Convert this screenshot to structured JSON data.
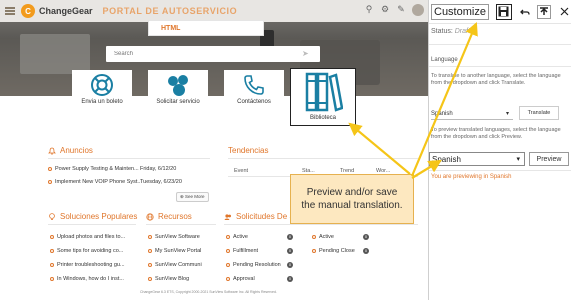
{
  "header": {
    "brand": "ChangeGear",
    "portal_title": "PORTAL DE AUTOSERVICIO",
    "html_box": "HTML",
    "search_placeholder": "Search"
  },
  "tiles": [
    {
      "label": "Envia un boleto",
      "icon": "lifebuoy-icon"
    },
    {
      "label": "Solicitar servicio",
      "icon": "service-request-icon"
    },
    {
      "label": "Contáctenos",
      "icon": "phone-icon"
    },
    {
      "label": "Biblioteca",
      "icon": "books-icon"
    }
  ],
  "anuncios": {
    "title": "Anuncios",
    "items": [
      {
        "text": "Power Supply Testing & Mainten...",
        "date": "Friday, 6/12/20"
      },
      {
        "text": "Implement New VOIP Phone Syst...",
        "date": "Tuesday, 6/23/20"
      }
    ],
    "see_more": "See More"
  },
  "tendencias": {
    "title": "Tendencias",
    "columns": [
      "Event",
      "Sta...",
      "Trend",
      "Wor..."
    ]
  },
  "soluciones": {
    "title": "Soluciones Populares",
    "items": [
      "Upload photos and files to...",
      "Some tips for avoiding co...",
      "Printer troubleshooting gu...",
      "In Windows, how do I inst..."
    ]
  },
  "recursos": {
    "title": "Recursos",
    "items": [
      "SunView Software",
      "My SunView Portal",
      "SunView Communi",
      "SunView Blog"
    ]
  },
  "solicitudes": {
    "title": "Solicitudes De Se",
    "col1": [
      {
        "label": "Active",
        "count": "0"
      },
      {
        "label": "Fulfillment",
        "count": "0"
      },
      {
        "label": "Pending Resolution",
        "count": "0"
      },
      {
        "label": "Approval",
        "count": "0"
      }
    ],
    "col2": [
      {
        "label": "Active",
        "count": "0"
      },
      {
        "label": "Pending Close",
        "count": "0"
      }
    ]
  },
  "footer": "ChangeGear 6.3 ETS, Copyright 2000-2021 SunView Software Inc. All Rights Reserved.",
  "panel": {
    "title": "Customize",
    "status_label": "Status:",
    "status_value": "Draft",
    "language_heading": "Language",
    "translate_help": "To translate to another language, select the language from the dropdown and click Translate.",
    "translate_select": "Spanish",
    "translate_button": "Translate",
    "preview_help": "To preview translated languages, select the language from the dropdown and click Preview.",
    "preview_select": "Spanish",
    "preview_button": "Preview",
    "previewing_note": "You are previewing in Spanish"
  },
  "callout": {
    "text": "Preview and/or save the manual translation."
  },
  "colors": {
    "accent": "#e0762b",
    "callout_bg": "#fde8c0",
    "arrow": "#f5c518"
  }
}
